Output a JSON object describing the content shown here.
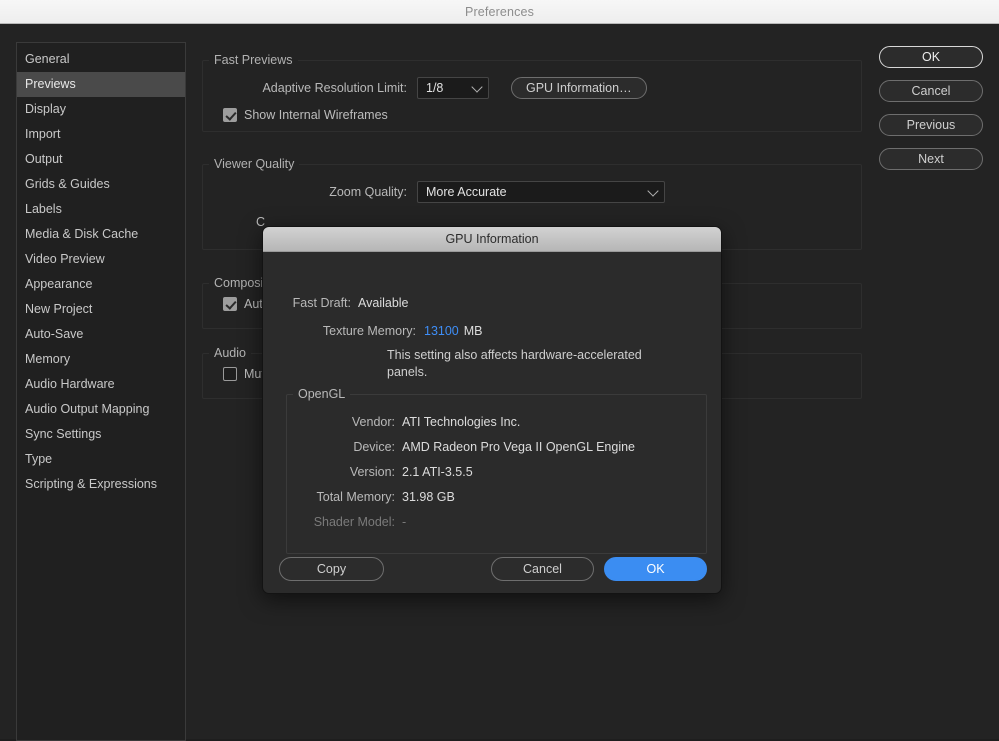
{
  "window": {
    "title": "Preferences"
  },
  "sidebar": {
    "items": [
      {
        "label": "General",
        "selected": false
      },
      {
        "label": "Previews",
        "selected": true
      },
      {
        "label": "Display",
        "selected": false
      },
      {
        "label": "Import",
        "selected": false
      },
      {
        "label": "Output",
        "selected": false
      },
      {
        "label": "Grids & Guides",
        "selected": false
      },
      {
        "label": "Labels",
        "selected": false
      },
      {
        "label": "Media & Disk Cache",
        "selected": false
      },
      {
        "label": "Video Preview",
        "selected": false
      },
      {
        "label": "Appearance",
        "selected": false
      },
      {
        "label": "New Project",
        "selected": false
      },
      {
        "label": "Auto-Save",
        "selected": false
      },
      {
        "label": "Memory",
        "selected": false
      },
      {
        "label": "Audio Hardware",
        "selected": false
      },
      {
        "label": "Audio Output Mapping",
        "selected": false
      },
      {
        "label": "Sync Settings",
        "selected": false
      },
      {
        "label": "Type",
        "selected": false
      },
      {
        "label": "Scripting & Expressions",
        "selected": false
      }
    ]
  },
  "sections": {
    "fast_previews": {
      "title": "Fast Previews",
      "adaptive_resolution_label": "Adaptive Resolution Limit:",
      "adaptive_resolution_value": "1/8",
      "gpu_info_button": "GPU Information…",
      "wireframes_label": "Show Internal Wireframes",
      "wireframes_checked": true
    },
    "viewer_quality": {
      "title": "Viewer Quality",
      "zoom_quality_label": "Zoom Quality:",
      "zoom_quality_value": "More Accurate",
      "second_label": "C"
    },
    "compositing": {
      "title": "Composit",
      "checkbox_label": "Auto",
      "checked": true
    },
    "audio": {
      "title": "Audio",
      "checkbox_label": "Mute",
      "checked": false
    }
  },
  "right_buttons": [
    {
      "label": "OK",
      "style": "default"
    },
    {
      "label": "Cancel",
      "style": "normal"
    },
    {
      "label": "Previous",
      "style": "normal"
    },
    {
      "label": "Next",
      "style": "normal"
    }
  ],
  "gpu_dialog": {
    "title": "GPU Information",
    "fast_draft_label": "Fast Draft:",
    "fast_draft_value": "Available",
    "texture_memory_label": "Texture Memory:",
    "texture_memory_value": "13100",
    "texture_memory_unit": "MB",
    "texture_memory_note": "This setting also affects hardware-accelerated panels.",
    "opengl": {
      "title": "OpenGL",
      "rows": [
        {
          "label": "Vendor:",
          "value": "ATI Technologies Inc.",
          "dim": false
        },
        {
          "label": "Device:",
          "value": "AMD Radeon Pro Vega II OpenGL Engine",
          "dim": false
        },
        {
          "label": "Version:",
          "value": "2.1 ATI-3.5.5",
          "dim": false
        },
        {
          "label": "Total Memory:",
          "value": "31.98 GB",
          "dim": false
        },
        {
          "label": "Shader Model:",
          "value": "-",
          "dim": true
        }
      ]
    },
    "buttons": {
      "copy": "Copy",
      "cancel": "Cancel",
      "ok": "OK"
    }
  },
  "colors": {
    "window_bg": "#232323",
    "sidebar_bg": "#202020",
    "selection": "#4a4a4a",
    "accent_blue": "#3b8df2",
    "texture_value_blue": "#3e8ef7"
  }
}
